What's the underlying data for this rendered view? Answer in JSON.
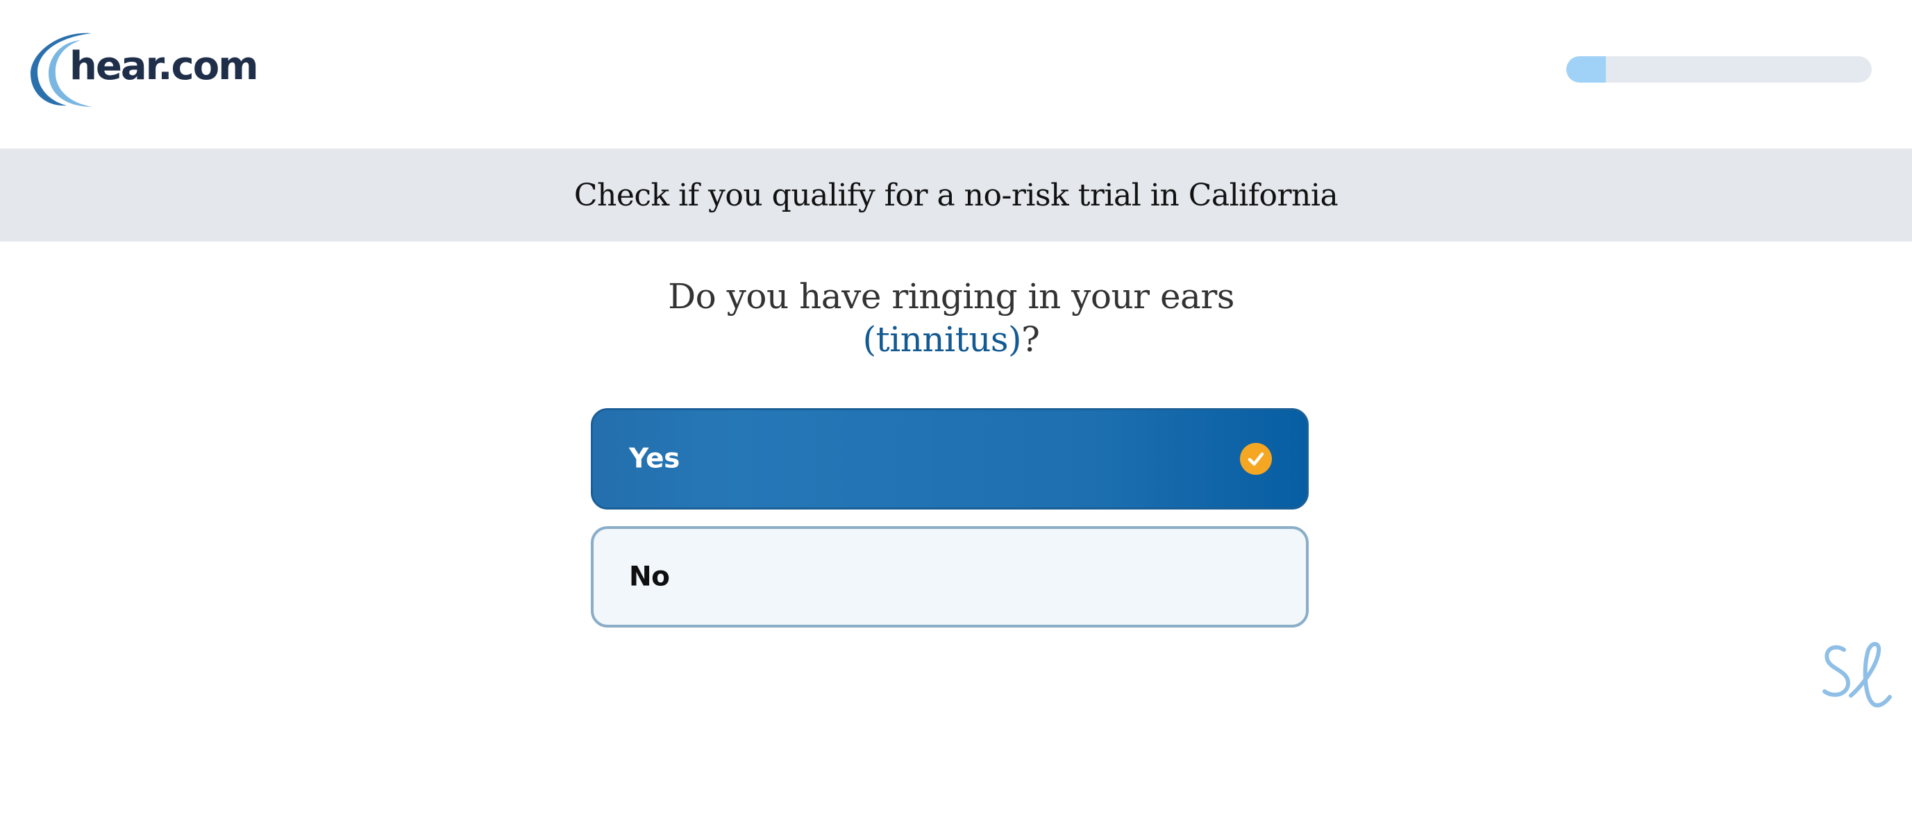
{
  "header": {
    "logo_text": "hear.com",
    "logo_icon": "arc-icon",
    "progress_fraction": 0.13
  },
  "banner": {
    "text": "Check if you qualify for a no-risk trial in California"
  },
  "question": {
    "line1": "Do you have ringing in your ears",
    "term": "(tinnitus)",
    "suffix": "?"
  },
  "options": [
    {
      "label": "Yes",
      "selected": true
    },
    {
      "label": "No",
      "selected": false
    }
  ],
  "colors": {
    "selected_bg": "#1d6fb0",
    "check": "#f5a623",
    "term": "#135a93",
    "banner_bg": "#e4e7ec",
    "progress_fill": "#9fd2f6",
    "progress_track": "#e4e8ef"
  }
}
